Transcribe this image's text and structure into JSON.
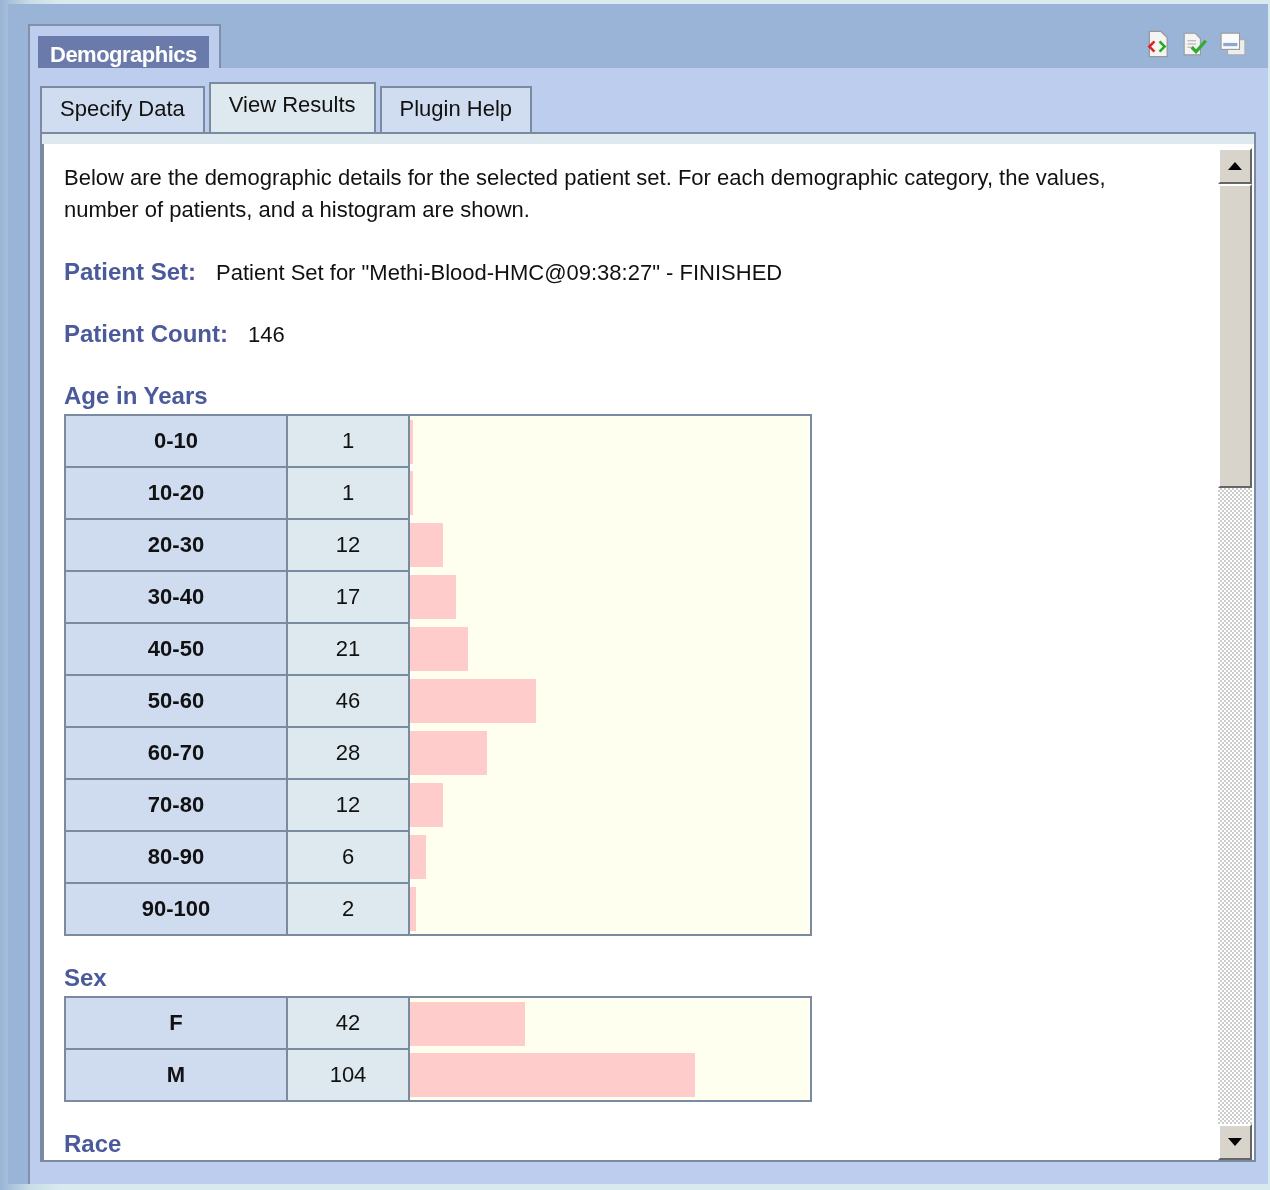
{
  "panel": {
    "title": "Demographics"
  },
  "tabs": [
    {
      "label": "Specify Data",
      "selected": false
    },
    {
      "label": "View Results",
      "selected": true
    },
    {
      "label": "Plugin Help",
      "selected": false
    }
  ],
  "intro": "Below are the demographic details for the selected patient set. For each demographic category, the values, number of patients, and a histogram are shown.",
  "fields": [
    {
      "label": "Patient Set:",
      "value": "Patient Set for \"Methi-Blood-HMC@09:38:27\" - FINISHED"
    },
    {
      "label": "Patient Count:",
      "value": "146"
    }
  ],
  "sections": [
    {
      "title": "Age in Years",
      "rows": [
        {
          "value": "0-10",
          "count": "1",
          "level": 0.007
        },
        {
          "value": "10-20",
          "count": "1",
          "level": 0.007
        },
        {
          "value": "20-30",
          "count": "12",
          "level": 0.082
        },
        {
          "value": "30-40",
          "count": "17",
          "level": 0.116
        },
        {
          "value": "40-50",
          "count": "21",
          "level": 0.144
        },
        {
          "value": "50-60",
          "count": "46",
          "level": 0.315
        },
        {
          "value": "60-70",
          "count": "28",
          "level": 0.192
        },
        {
          "value": "70-80",
          "count": "12",
          "level": 0.082
        },
        {
          "value": "80-90",
          "count": "6",
          "level": 0.041
        },
        {
          "value": "90-100",
          "count": "2",
          "level": 0.014
        }
      ]
    },
    {
      "title": "Sex",
      "rows": [
        {
          "value": "F",
          "count": "42",
          "level": 0.288
        },
        {
          "value": "M",
          "count": "104",
          "level": 0.712
        }
      ]
    },
    {
      "title": "Race"
    }
  ]
}
